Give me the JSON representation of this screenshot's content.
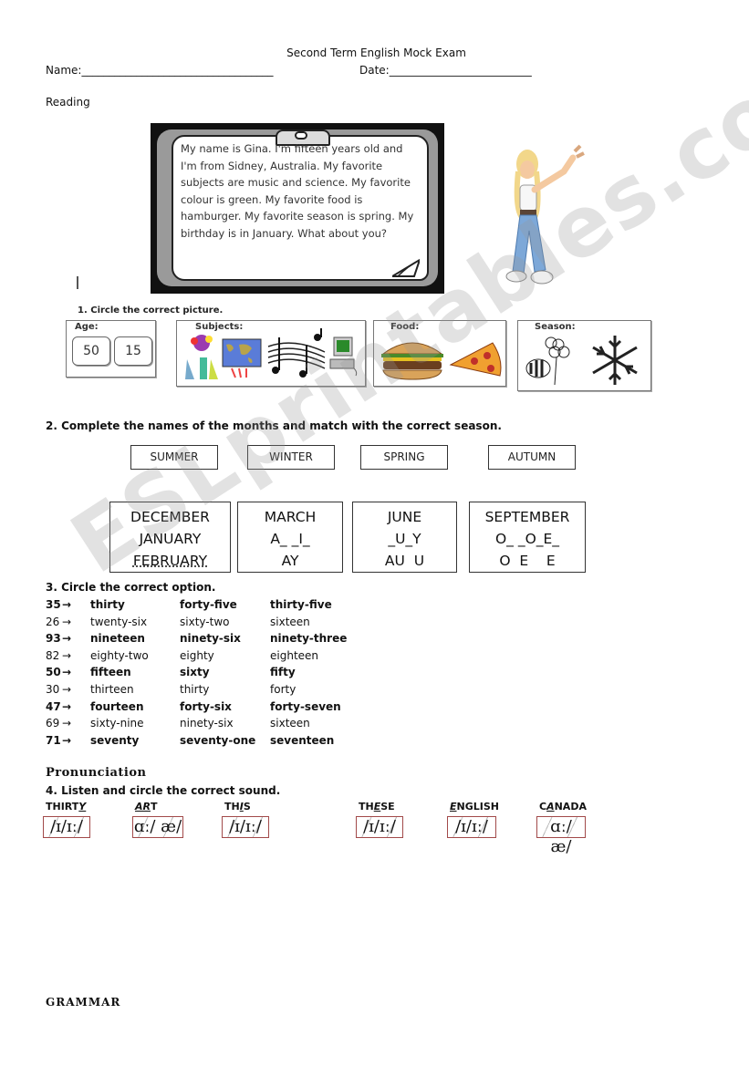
{
  "header": {
    "title": "Second Term English Mock Exam",
    "name_label": "Name:___________________________________",
    "date_label": "Date:__________________________",
    "section": "Reading"
  },
  "reading": {
    "text": "My name is Gina. I'm fifteen years old and I'm from Sidney, Australia. My favorite subjects are music and science. My favorite colour is green. My favorite food is hamburger.  My favorite season is spring.  My birthday  is in January. What about you?",
    "illustration": "girl-pointing-illustration"
  },
  "exercise1": {
    "instruction": "1. Circle the correct picture.",
    "boxes": [
      {
        "label": "Age:",
        "options": [
          "50",
          "15"
        ]
      },
      {
        "label": "Subjects:",
        "pictures": [
          "science-icon",
          "world-map-icon",
          "music-notes-icon",
          "computer-icon"
        ]
      },
      {
        "label": "Food:",
        "pictures": [
          "hamburger-icon",
          "pizza-icon"
        ]
      },
      {
        "label": "Season:",
        "pictures": [
          "bee-flower-icon",
          "snowflake-icon"
        ]
      }
    ]
  },
  "exercise2": {
    "instruction": "2. Complete the names of the months and match with the correct season.",
    "seasons": [
      "SUMMER",
      "WINTER",
      "SPRING",
      "AUTUMN"
    ],
    "month_groups": [
      [
        "DECEMBER",
        "JANUARY",
        "FEBRUARY"
      ],
      [
        "MARCH",
        "A_ _I_",
        "AY"
      ],
      [
        "JUNE",
        "_U_Y",
        "AU  U"
      ],
      [
        "SEPTEMBER",
        "O_ _O_E_",
        "O  E    E"
      ]
    ]
  },
  "exercise3": {
    "instruction": "3. Circle the correct option.",
    "rows": [
      {
        "num": "35",
        "bold": true,
        "options": [
          "thirty",
          "forty-five",
          "thirty-five"
        ]
      },
      {
        "num": "26",
        "bold": false,
        "options": [
          "twenty-six",
          "sixty-two",
          "sixteen"
        ]
      },
      {
        "num": "93",
        "bold": true,
        "options": [
          "nineteen",
          "ninety-six",
          "ninety-three"
        ]
      },
      {
        "num": "82",
        "bold": false,
        "options": [
          "eighty-two",
          "eighty",
          "eighteen"
        ]
      },
      {
        "num": "50",
        "bold": true,
        "options": [
          "fifteen",
          "sixty",
          "fifty"
        ]
      },
      {
        "num": "30",
        "bold": false,
        "options": [
          "thirteen",
          "thirty",
          "forty"
        ]
      },
      {
        "num": "47",
        "bold": true,
        "options": [
          "fourteen",
          "forty-six",
          "forty-seven"
        ]
      },
      {
        "num": "69",
        "bold": false,
        "options": [
          "sixty-nine",
          "ninety-six",
          "sixteen"
        ]
      },
      {
        "num": "71",
        "bold": true,
        "options": [
          "seventy",
          "seventy-one",
          "seventeen"
        ]
      }
    ],
    "arrow": "→"
  },
  "pronunciation": {
    "heading": "Pronunciation",
    "instruction": "4. Listen and circle the correct sound.",
    "items": [
      {
        "pre": "THIRT",
        "mark": "Y",
        "post": "",
        "sounds": "/ɪ/ɪː/"
      },
      {
        "pre": "",
        "mark": "AR",
        "post": "T",
        "sounds": "ɑː/ æ/"
      },
      {
        "pre": "TH",
        "mark": "I",
        "post": "S",
        "sounds": "/ɪ/ɪː/"
      },
      {
        "pre": "TH",
        "mark": "E",
        "post": "SE",
        "sounds": "/ɪ/ɪː/"
      },
      {
        "pre": "",
        "mark": "E",
        "post": "NGLISH",
        "sounds": "/ɪ/ɪː/"
      },
      {
        "pre": "C",
        "mark": "A",
        "post": "NADA",
        "sounds": "ɑː/ æ/"
      }
    ]
  },
  "grammar": {
    "heading": "GRAMMAR"
  },
  "watermark": "ESLprintables.com"
}
